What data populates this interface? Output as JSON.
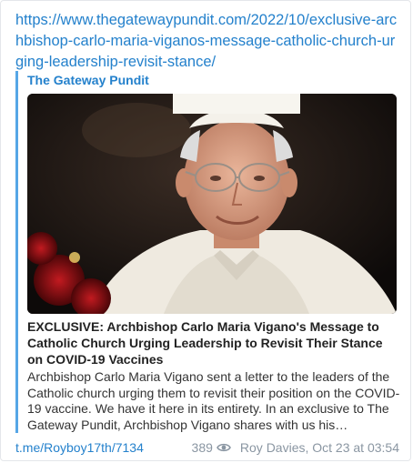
{
  "message": {
    "url": "https://www.thegatewaypundit.com/2022/10/exclusive-archbishop-carlo-maria-viganos-message-catholic-church-urging-leadership-revisit-stance/",
    "preview": {
      "site_name": "The Gateway Pundit",
      "title": "EXCLUSIVE: Archbishop Carlo Maria Vigano's Message to Catholic Church Urging Leadership to Revisit Their Stance on COVID-19 Vaccines",
      "description": "Archbishop Carlo Maria Vigano sent a letter to the leaders of the Catholic church urging them to revisit their position on the COVID-19 vaccine.  We have it here in its entirety. In an exclusive to The Gateway Pundit, Archbishop Vigano shares with us his…"
    },
    "footer": {
      "post_link": "t.me/Royboy17th/7134",
      "views": "389",
      "author_date": "Roy Davies, Oct 23 at 03:54"
    }
  },
  "colors": {
    "link": "#2481cc",
    "accent_bar": "#56a6e6",
    "meta": "#8a96a2"
  }
}
